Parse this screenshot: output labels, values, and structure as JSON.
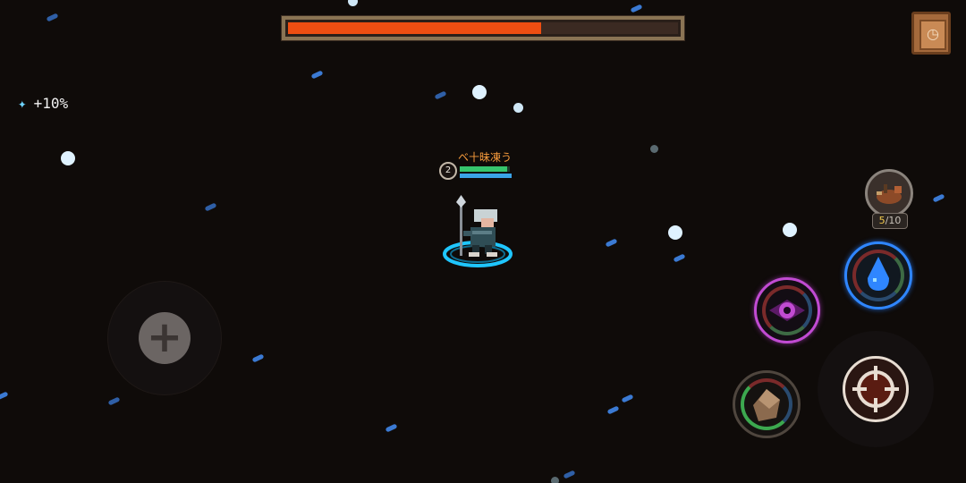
{
  "boss_bar": {
    "fill_fraction": 0.65,
    "fill_color": "#ee4e12"
  },
  "bag_button": {
    "icon": "journal-icon"
  },
  "buff": {
    "icon": "sparkle-icon",
    "value": "+10%"
  },
  "player": {
    "name": "ベ十昧凍う",
    "level": "2",
    "hp_fraction": 0.95,
    "mp_fraction": 1.0
  },
  "pet": {
    "current": "5",
    "max": "10",
    "separator": "/"
  },
  "skills": {
    "water": {
      "icon": "water-drop-icon",
      "color": "#2f86ff"
    },
    "eye": {
      "icon": "eye-icon",
      "color": "#c14bd2"
    },
    "shield": {
      "icon": "shield-icon",
      "color": "#8b6a4e"
    },
    "attack": {
      "icon": "crosshair-icon",
      "color": "#e8ddd2"
    }
  },
  "joystick": {
    "icon": "dpad-plus-icon"
  }
}
